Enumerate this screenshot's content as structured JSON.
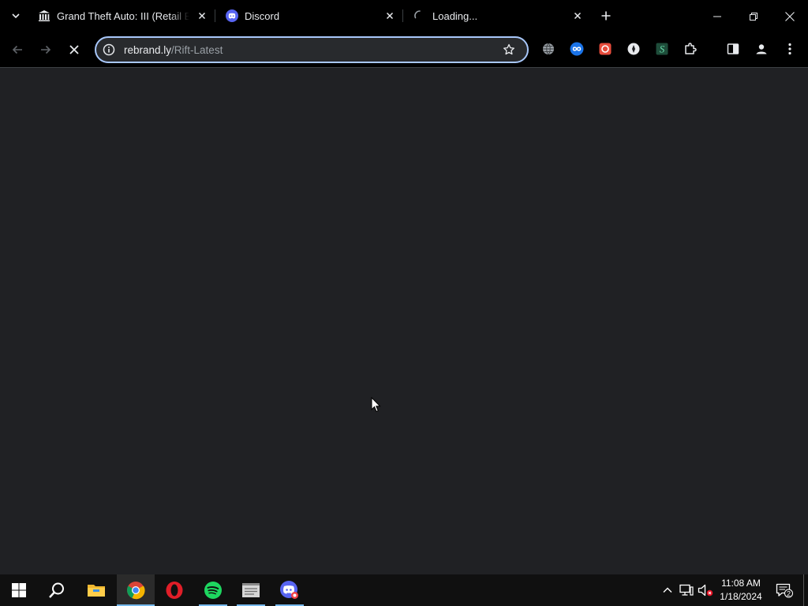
{
  "browser": {
    "tabs": [
      {
        "title": "Grand Theft Auto: III (Retail Edit",
        "icon": "museum-icon",
        "active": false
      },
      {
        "title": "Discord",
        "icon": "discord-icon",
        "active": false
      },
      {
        "title": "Loading...",
        "icon": "loading-spinner-icon",
        "active": true
      }
    ],
    "address_bar": {
      "host": "rebrand.ly",
      "path": "/Rift-Latest"
    },
    "page_loading": true,
    "extensions": [
      "globe-extension-icon",
      "infinity-extension-icon",
      "red-square-extension-icon",
      "compass-extension-icon",
      "s-extension-icon",
      "puzzle-extensions-icon"
    ],
    "extension_s_label": "S"
  },
  "taskbar": {
    "apps": [
      "start-button",
      "search",
      "file-explorer",
      "chrome",
      "opera",
      "spotify",
      "notepad-app",
      "discord-app"
    ],
    "clock": {
      "time": "11:08 AM",
      "date": "1/18/2024"
    },
    "notification_count": "2"
  },
  "colors": {
    "page_bg": "#202124",
    "chrome_frame": "#000000",
    "omnibox_focus": "#a8c7fa",
    "taskbar": "#101010"
  }
}
